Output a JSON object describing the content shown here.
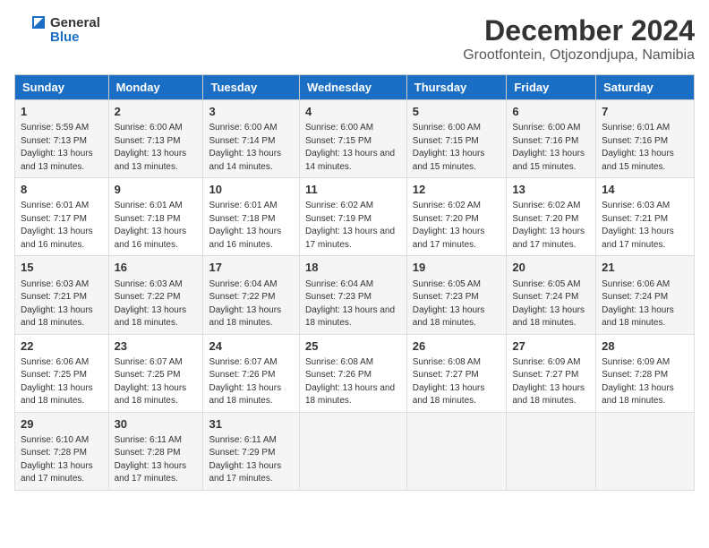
{
  "logo": {
    "general": "General",
    "blue": "Blue"
  },
  "title": "December 2024",
  "subtitle": "Grootfontein, Otjozondjupa, Namibia",
  "days_header": [
    "Sunday",
    "Monday",
    "Tuesday",
    "Wednesday",
    "Thursday",
    "Friday",
    "Saturday"
  ],
  "weeks": [
    [
      {
        "day": "1",
        "sunrise": "Sunrise: 5:59 AM",
        "sunset": "Sunset: 7:13 PM",
        "daylight": "Daylight: 13 hours and 13 minutes."
      },
      {
        "day": "2",
        "sunrise": "Sunrise: 6:00 AM",
        "sunset": "Sunset: 7:13 PM",
        "daylight": "Daylight: 13 hours and 13 minutes."
      },
      {
        "day": "3",
        "sunrise": "Sunrise: 6:00 AM",
        "sunset": "Sunset: 7:14 PM",
        "daylight": "Daylight: 13 hours and 14 minutes."
      },
      {
        "day": "4",
        "sunrise": "Sunrise: 6:00 AM",
        "sunset": "Sunset: 7:15 PM",
        "daylight": "Daylight: 13 hours and 14 minutes."
      },
      {
        "day": "5",
        "sunrise": "Sunrise: 6:00 AM",
        "sunset": "Sunset: 7:15 PM",
        "daylight": "Daylight: 13 hours and 15 minutes."
      },
      {
        "day": "6",
        "sunrise": "Sunrise: 6:00 AM",
        "sunset": "Sunset: 7:16 PM",
        "daylight": "Daylight: 13 hours and 15 minutes."
      },
      {
        "day": "7",
        "sunrise": "Sunrise: 6:01 AM",
        "sunset": "Sunset: 7:16 PM",
        "daylight": "Daylight: 13 hours and 15 minutes."
      }
    ],
    [
      {
        "day": "8",
        "sunrise": "Sunrise: 6:01 AM",
        "sunset": "Sunset: 7:17 PM",
        "daylight": "Daylight: 13 hours and 16 minutes."
      },
      {
        "day": "9",
        "sunrise": "Sunrise: 6:01 AM",
        "sunset": "Sunset: 7:18 PM",
        "daylight": "Daylight: 13 hours and 16 minutes."
      },
      {
        "day": "10",
        "sunrise": "Sunrise: 6:01 AM",
        "sunset": "Sunset: 7:18 PM",
        "daylight": "Daylight: 13 hours and 16 minutes."
      },
      {
        "day": "11",
        "sunrise": "Sunrise: 6:02 AM",
        "sunset": "Sunset: 7:19 PM",
        "daylight": "Daylight: 13 hours and 17 minutes."
      },
      {
        "day": "12",
        "sunrise": "Sunrise: 6:02 AM",
        "sunset": "Sunset: 7:20 PM",
        "daylight": "Daylight: 13 hours and 17 minutes."
      },
      {
        "day": "13",
        "sunrise": "Sunrise: 6:02 AM",
        "sunset": "Sunset: 7:20 PM",
        "daylight": "Daylight: 13 hours and 17 minutes."
      },
      {
        "day": "14",
        "sunrise": "Sunrise: 6:03 AM",
        "sunset": "Sunset: 7:21 PM",
        "daylight": "Daylight: 13 hours and 17 minutes."
      }
    ],
    [
      {
        "day": "15",
        "sunrise": "Sunrise: 6:03 AM",
        "sunset": "Sunset: 7:21 PM",
        "daylight": "Daylight: 13 hours and 18 minutes."
      },
      {
        "day": "16",
        "sunrise": "Sunrise: 6:03 AM",
        "sunset": "Sunset: 7:22 PM",
        "daylight": "Daylight: 13 hours and 18 minutes."
      },
      {
        "day": "17",
        "sunrise": "Sunrise: 6:04 AM",
        "sunset": "Sunset: 7:22 PM",
        "daylight": "Daylight: 13 hours and 18 minutes."
      },
      {
        "day": "18",
        "sunrise": "Sunrise: 6:04 AM",
        "sunset": "Sunset: 7:23 PM",
        "daylight": "Daylight: 13 hours and 18 minutes."
      },
      {
        "day": "19",
        "sunrise": "Sunrise: 6:05 AM",
        "sunset": "Sunset: 7:23 PM",
        "daylight": "Daylight: 13 hours and 18 minutes."
      },
      {
        "day": "20",
        "sunrise": "Sunrise: 6:05 AM",
        "sunset": "Sunset: 7:24 PM",
        "daylight": "Daylight: 13 hours and 18 minutes."
      },
      {
        "day": "21",
        "sunrise": "Sunrise: 6:06 AM",
        "sunset": "Sunset: 7:24 PM",
        "daylight": "Daylight: 13 hours and 18 minutes."
      }
    ],
    [
      {
        "day": "22",
        "sunrise": "Sunrise: 6:06 AM",
        "sunset": "Sunset: 7:25 PM",
        "daylight": "Daylight: 13 hours and 18 minutes."
      },
      {
        "day": "23",
        "sunrise": "Sunrise: 6:07 AM",
        "sunset": "Sunset: 7:25 PM",
        "daylight": "Daylight: 13 hours and 18 minutes."
      },
      {
        "day": "24",
        "sunrise": "Sunrise: 6:07 AM",
        "sunset": "Sunset: 7:26 PM",
        "daylight": "Daylight: 13 hours and 18 minutes."
      },
      {
        "day": "25",
        "sunrise": "Sunrise: 6:08 AM",
        "sunset": "Sunset: 7:26 PM",
        "daylight": "Daylight: 13 hours and 18 minutes."
      },
      {
        "day": "26",
        "sunrise": "Sunrise: 6:08 AM",
        "sunset": "Sunset: 7:27 PM",
        "daylight": "Daylight: 13 hours and 18 minutes."
      },
      {
        "day": "27",
        "sunrise": "Sunrise: 6:09 AM",
        "sunset": "Sunset: 7:27 PM",
        "daylight": "Daylight: 13 hours and 18 minutes."
      },
      {
        "day": "28",
        "sunrise": "Sunrise: 6:09 AM",
        "sunset": "Sunset: 7:28 PM",
        "daylight": "Daylight: 13 hours and 18 minutes."
      }
    ],
    [
      {
        "day": "29",
        "sunrise": "Sunrise: 6:10 AM",
        "sunset": "Sunset: 7:28 PM",
        "daylight": "Daylight: 13 hours and 17 minutes."
      },
      {
        "day": "30",
        "sunrise": "Sunrise: 6:11 AM",
        "sunset": "Sunset: 7:28 PM",
        "daylight": "Daylight: 13 hours and 17 minutes."
      },
      {
        "day": "31",
        "sunrise": "Sunrise: 6:11 AM",
        "sunset": "Sunset: 7:29 PM",
        "daylight": "Daylight: 13 hours and 17 minutes."
      },
      {
        "day": "",
        "sunrise": "",
        "sunset": "",
        "daylight": ""
      },
      {
        "day": "",
        "sunrise": "",
        "sunset": "",
        "daylight": ""
      },
      {
        "day": "",
        "sunrise": "",
        "sunset": "",
        "daylight": ""
      },
      {
        "day": "",
        "sunrise": "",
        "sunset": "",
        "daylight": ""
      }
    ]
  ]
}
